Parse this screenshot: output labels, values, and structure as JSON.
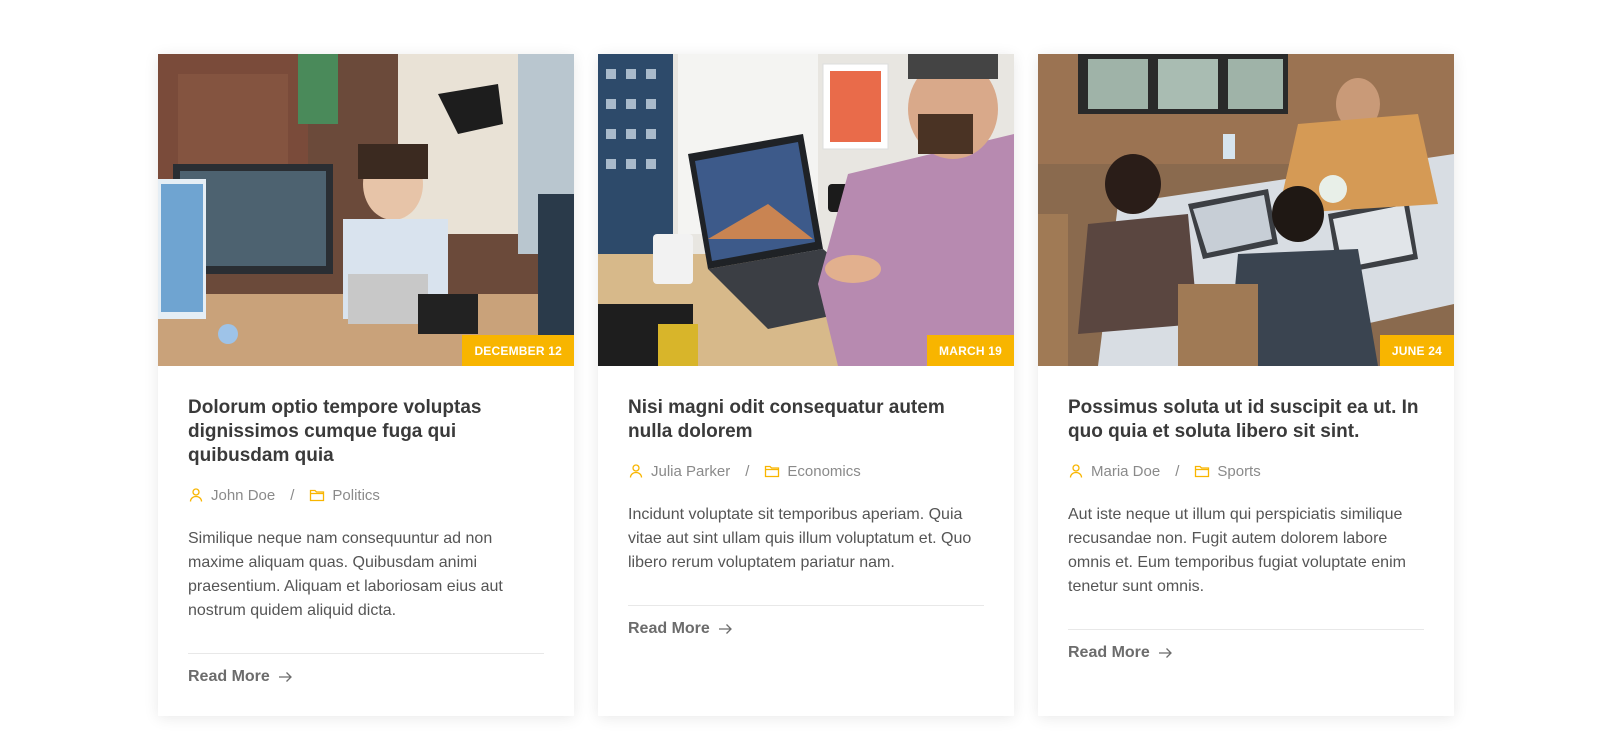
{
  "accent_color": "#f8b500",
  "posts": [
    {
      "date": "DECEMBER 12",
      "title": "Dolorum optio tempore voluptas dignissimos cumque fuga qui quibusdam quia",
      "author": "John Doe",
      "category": "Politics",
      "excerpt": "Similique neque nam consequuntur ad non maxime aliquam quas. Quibusdam animi praesentium. Aliquam et laboriosam eius aut nostrum quidem aliquid dicta.",
      "read_more": "Read More",
      "author_icon": "user-icon",
      "category_icon": "folder-icon"
    },
    {
      "date": "MARCH 19",
      "title": "Nisi magni odit consequatur autem nulla dolorem",
      "author": "Julia Parker",
      "category": "Economics",
      "excerpt": "Incidunt voluptate sit temporibus aperiam. Quia vitae aut sint ullam quis illum voluptatum et. Quo libero rerum voluptatem pariatur nam.",
      "read_more": "Read More",
      "author_icon": "user-icon",
      "category_icon": "folder-icon"
    },
    {
      "date": "JUNE 24",
      "title": "Possimus soluta ut id suscipit ea ut. In quo quia et soluta libero sit sint.",
      "author": "Maria Doe",
      "category": "Sports",
      "excerpt": "Aut iste neque ut illum qui perspiciatis similique recusandae non. Fugit autem dolorem labore omnis et. Eum temporibus fugiat voluptate enim tenetur sunt omnis.",
      "read_more": "Read More",
      "author_icon": "user-icon",
      "category_icon": "folder-icon"
    }
  ]
}
